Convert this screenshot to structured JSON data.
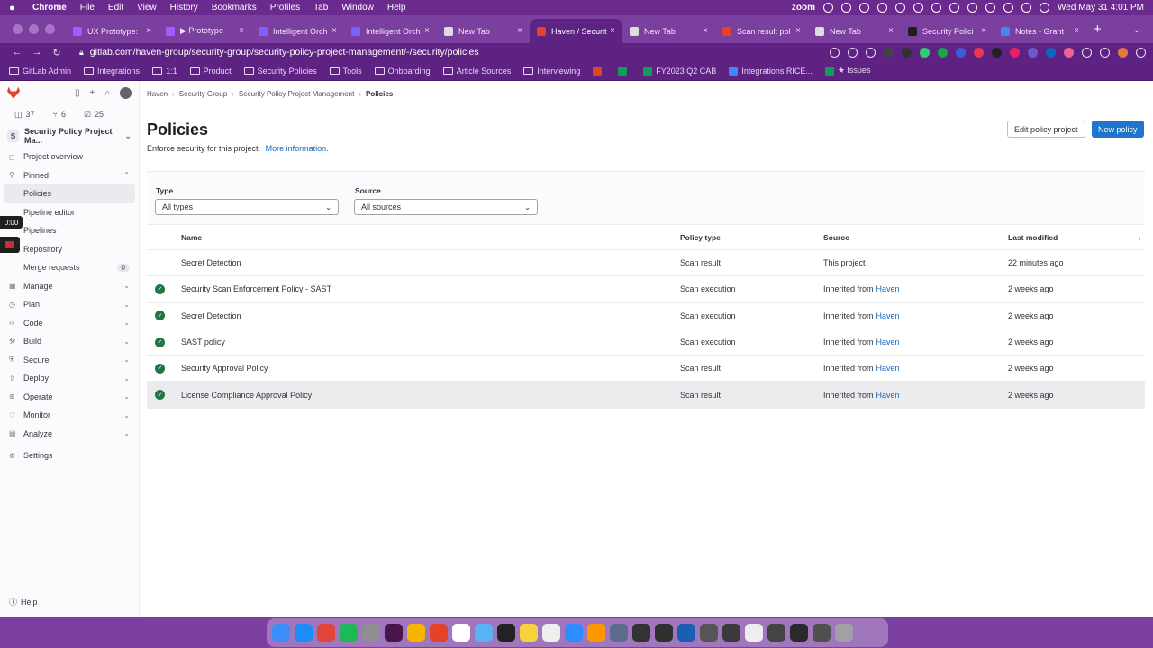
{
  "menubar": {
    "app": "Chrome",
    "items": [
      "File",
      "Edit",
      "View",
      "History",
      "Bookmarks",
      "Profiles",
      "Tab",
      "Window",
      "Help"
    ],
    "zoom_label": "zoom",
    "datetime": "Wed May 31  4:01 PM"
  },
  "tabs": [
    {
      "title": "UX Prototype: ",
      "color": "#a259ff"
    },
    {
      "title": "▶ Prototype - ",
      "color": "#a259ff"
    },
    {
      "title": "Intelligent Orch",
      "color": "#7b61ff"
    },
    {
      "title": "Intelligent Orch",
      "color": "#7b61ff"
    },
    {
      "title": "New Tab",
      "color": "#dddddd"
    },
    {
      "title": "Haven / Securit",
      "color": "#e24329"
    },
    {
      "title": "New Tab",
      "color": "#dddddd"
    },
    {
      "title": "Scan result pol",
      "color": "#e24329"
    },
    {
      "title": "New Tab",
      "color": "#dddddd"
    },
    {
      "title": "Security Polici",
      "color": "#1f1f1f"
    },
    {
      "title": "Notes - Grant",
      "color": "#4285f4"
    }
  ],
  "active_tab_index": 5,
  "address_bar": {
    "url": "gitlab.com/haven-group/security-group/security-policy-project-management/-/security/policies"
  },
  "bookmarks": [
    {
      "label": "GitLab Admin",
      "kind": "folder"
    },
    {
      "label": "Integrations",
      "kind": "folder"
    },
    {
      "label": "1:1",
      "kind": "folder"
    },
    {
      "label": "Product",
      "kind": "folder"
    },
    {
      "label": "Security Policies",
      "kind": "folder"
    },
    {
      "label": "Tools",
      "kind": "folder"
    },
    {
      "label": "Onboarding",
      "kind": "folder"
    },
    {
      "label": "Article Sources",
      "kind": "folder"
    },
    {
      "label": "Interviewing",
      "kind": "folder"
    },
    {
      "label": "",
      "kind": "site",
      "color": "#e24329"
    },
    {
      "label": "",
      "kind": "site",
      "color": "#0f9d58"
    },
    {
      "label": "FY2023 Q2 CAB",
      "kind": "site",
      "color": "#0f9d58"
    },
    {
      "label": "Integrations RICE...",
      "kind": "site",
      "color": "#4285f4"
    },
    {
      "label": "★ Issues",
      "kind": "site",
      "color": "#0f9d58"
    }
  ],
  "sidebar": {
    "counts": {
      "issues": "37",
      "merge_requests": "6",
      "todos": "25"
    },
    "project_initial": "S",
    "project_name": "Security Policy Project Ma...",
    "project_overview": "Project overview",
    "pinned_label": "Pinned",
    "pinned_items": [
      "Policies",
      "Pipeline editor",
      "Pipelines",
      "Repository"
    ],
    "merge_requests_label": "Merge requests",
    "merge_requests_count": "0",
    "sections": [
      "Manage",
      "Plan",
      "Code",
      "Build",
      "Secure",
      "Deploy",
      "Operate",
      "Monitor",
      "Analyze",
      "Settings"
    ],
    "help_label": "Help"
  },
  "recorder": {
    "time": "0:00"
  },
  "breadcrumb": [
    "Haven",
    "Security Group",
    "Security Policy Project Management",
    "Policies"
  ],
  "page": {
    "title": "Policies",
    "description": "Enforce security for this project.",
    "more_info_link": "More information.",
    "edit_button": "Edit policy project",
    "new_button": "New policy"
  },
  "filters": {
    "type_label": "Type",
    "type_value": "All types",
    "source_label": "Source",
    "source_value": "All sources"
  },
  "table": {
    "columns": [
      "Name",
      "Policy type",
      "Source",
      "Last modified"
    ],
    "rows": [
      {
        "enabled": false,
        "name": "Secret Detection",
        "type": "Scan result",
        "source_prefix": "This project",
        "source_link": "",
        "modified": "22 minutes ago"
      },
      {
        "enabled": true,
        "name": "Security Scan Enforcement Policy - SAST",
        "type": "Scan execution",
        "source_prefix": "Inherited from",
        "source_link": "Haven",
        "modified": "2 weeks ago"
      },
      {
        "enabled": true,
        "name": "Secret Detection",
        "type": "Scan execution",
        "source_prefix": "Inherited from",
        "source_link": "Haven",
        "modified": "2 weeks ago"
      },
      {
        "enabled": true,
        "name": "SAST policy",
        "type": "Scan execution",
        "source_prefix": "Inherited from",
        "source_link": "Haven",
        "modified": "2 weeks ago"
      },
      {
        "enabled": true,
        "name": "Security Approval Policy",
        "type": "Scan result",
        "source_prefix": "Inherited from",
        "source_link": "Haven",
        "modified": "2 weeks ago"
      },
      {
        "enabled": true,
        "name": "License Compliance Approval Policy",
        "type": "Scan result",
        "source_prefix": "Inherited from",
        "source_link": "Haven",
        "modified": "2 weeks ago"
      }
    ],
    "hover_row_index": 5
  },
  "dock": {
    "icons": [
      "finder",
      "app-store",
      "chrome",
      "spotify",
      "system-settings",
      "slack",
      "sketch",
      "gitlab",
      "notion",
      "preview",
      "terminal",
      "notes",
      "textedit",
      "zoom",
      "sublime",
      "screen",
      "terminal-2",
      "obs",
      "1password",
      "window",
      "window",
      "window",
      "window",
      "window",
      "window",
      "trash"
    ],
    "colors": [
      "#3d8ef7",
      "#1c8cf6",
      "#e2453c",
      "#1db954",
      "#8e8e93",
      "#4a154b",
      "#f7b500",
      "#e24329",
      "#ffffff",
      "#5ab2f6",
      "#222222",
      "#f8d13f",
      "#eeeeee",
      "#2d8cff",
      "#ff9800",
      "#5b6b8c",
      "#333333",
      "#303030",
      "#1a5fb4",
      "#555555",
      "#3a3a3a",
      "#eeeeee",
      "#444444",
      "#2a2a2a",
      "#505050",
      "#a0a0a6"
    ]
  }
}
